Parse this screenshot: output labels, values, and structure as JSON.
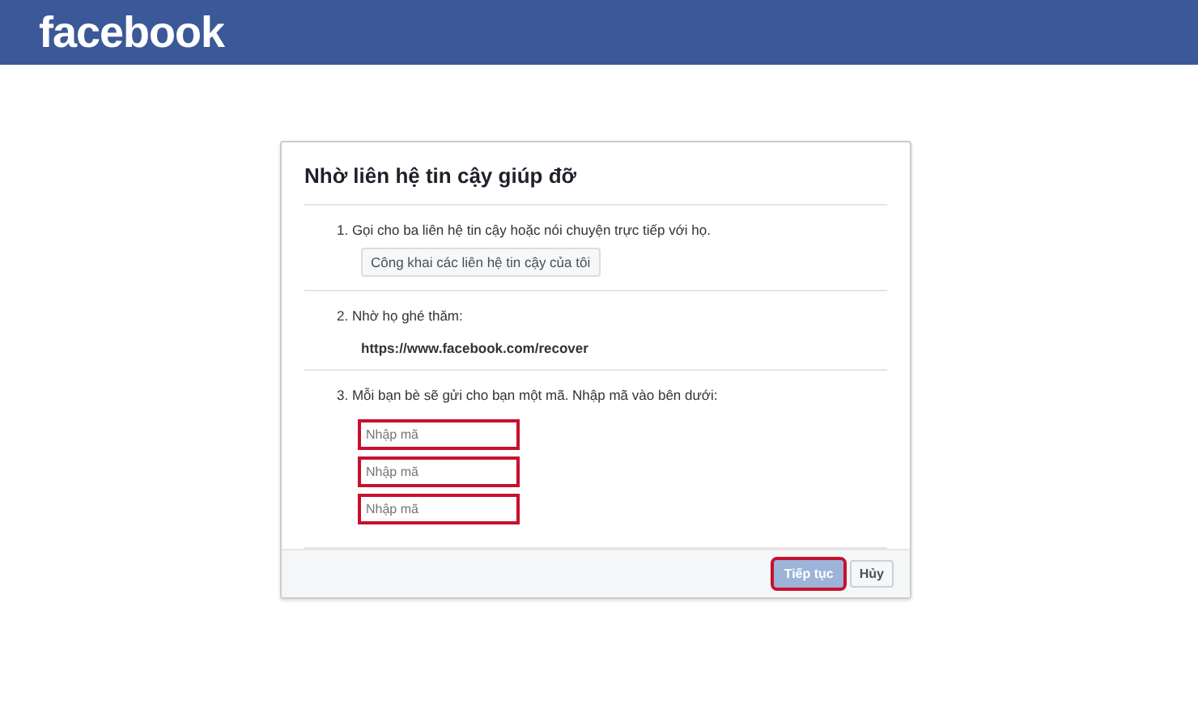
{
  "header": {
    "logo": "facebook"
  },
  "dialog": {
    "title": "Nhờ liên hệ tin cậy giúp đỡ",
    "steps": [
      {
        "kind": "button",
        "text": "1. Gọi cho ba liên hệ tin cậy hoặc nói chuyện trực tiếp với họ.",
        "button": "Công khai các liên hệ tin cậy của tôi"
      },
      {
        "kind": "link",
        "text": "2. Nhờ họ ghé thăm:",
        "link": "https://www.facebook.com/recover"
      },
      {
        "kind": "codes",
        "text": "3. Mỗi bạn bè sẽ gửi cho bạn một mã. Nhập mã vào bên dưới:",
        "fields": [
          {
            "placeholder": "Nhập mã",
            "highlighted": true
          },
          {
            "placeholder": "Nhập mã",
            "highlighted": true
          },
          {
            "placeholder": "Nhập mã",
            "highlighted": true
          }
        ]
      }
    ],
    "buttons": [
      {
        "label": "Tiếp tục",
        "kind": "primary",
        "disabled": true,
        "highlighted": true
      },
      {
        "label": "Hủy",
        "kind": "secondary",
        "disabled": false,
        "highlighted": false
      }
    ]
  }
}
